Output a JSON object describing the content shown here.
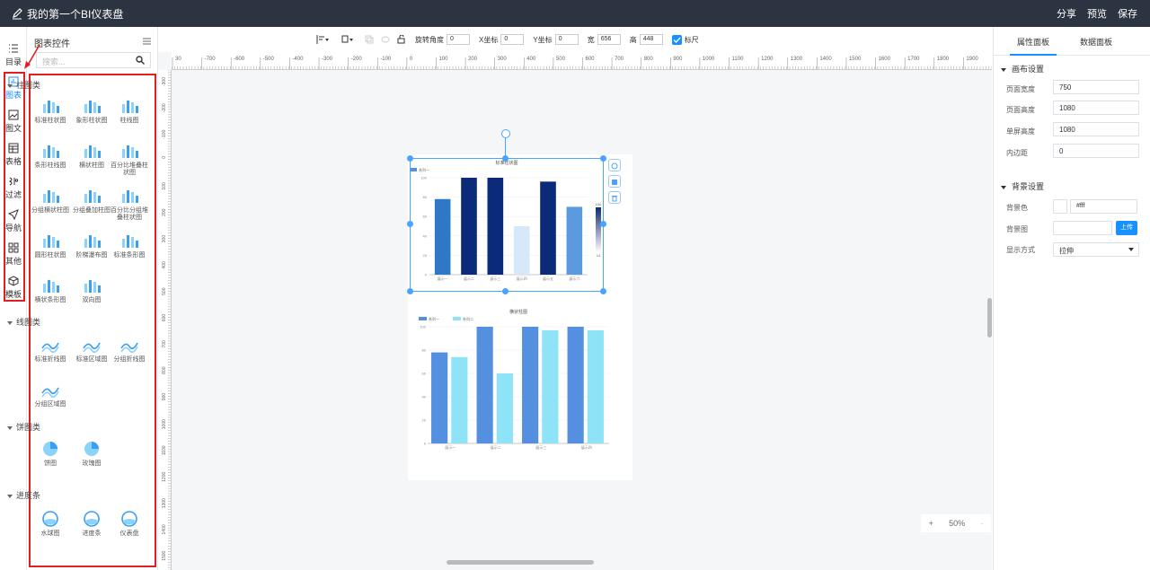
{
  "header": {
    "title": "我的第一个BI仪表盘",
    "actions": [
      "分享",
      "预览",
      "保存"
    ]
  },
  "rail": {
    "items": [
      {
        "label": "目录",
        "icon": "list-icon"
      },
      {
        "label": "图表",
        "icon": "chart-icon",
        "active": true
      },
      {
        "label": "图文",
        "icon": "image-text-icon"
      },
      {
        "label": "表格",
        "icon": "table-icon"
      },
      {
        "label": "过滤",
        "icon": "filter-icon"
      },
      {
        "label": "导航",
        "icon": "navigation-icon"
      },
      {
        "label": "其他",
        "icon": "grid-icon"
      },
      {
        "label": "模板",
        "icon": "cube-icon"
      }
    ]
  },
  "panel": {
    "title": "图表控件",
    "search_placeholder": "搜索...",
    "sections": [
      {
        "name": "柱图类",
        "items": [
          "标准柱状图",
          "象形柱状图",
          "柱线图",
          "条形柱线图",
          "横状柱图",
          "百分比堆叠柱状图",
          "分组横状柱图",
          "分组叠加柱图",
          "百分比分组堆叠柱状图",
          "圆形柱状图",
          "阶梯瀑布图",
          "标准条形图",
          "横状条形图",
          "双向图"
        ]
      },
      {
        "name": "线图类",
        "items": [
          "标准折线图",
          "标准区域图",
          "分组折线图",
          "分组区域图"
        ]
      },
      {
        "name": "饼图类",
        "items": [
          "饼图",
          "玫瑰图"
        ]
      },
      {
        "name": "进度条",
        "items": [
          "水球图",
          "进度条",
          "仪表盘"
        ]
      }
    ]
  },
  "toolbar": {
    "rotate_label": "旋转角度",
    "rotate_value": "0",
    "x_label": "X坐标",
    "x_value": "0",
    "y_label": "Y坐标",
    "y_value": "0",
    "width_label": "宽",
    "width_value": "656",
    "height_label": "高",
    "height_value": "448",
    "ruler_label": "标尺"
  },
  "ruler": {
    "h_ticks": [
      "30",
      "-700",
      "-600",
      "-500",
      "-400",
      "-300",
      "-200",
      "-100",
      "0",
      "100",
      "200",
      "300",
      "400",
      "500",
      "600",
      "700",
      "800",
      "900",
      "1000",
      "1100",
      "1200",
      "1300",
      "1400",
      "1500",
      "1600",
      "1700",
      "1800",
      "1900"
    ],
    "v_ticks": [
      "-300",
      "-200",
      "-100",
      "0",
      "100",
      "200",
      "300",
      "400",
      "500",
      "600",
      "700",
      "800",
      "900",
      "1000",
      "1100",
      "1200",
      "1300",
      "1400",
      "1500"
    ]
  },
  "chart_data": [
    {
      "type": "bar",
      "title": "标准柱状图",
      "categories": [
        "展示一",
        "展示二",
        "展示三",
        "展示四",
        "展示五",
        "展示六"
      ],
      "series": [
        {
          "name": "系列一",
          "values": [
            78,
            100,
            100,
            50,
            96,
            70
          ]
        }
      ],
      "colors": [
        "#2e78c7",
        "#0c2a7a",
        "#0c2a7a",
        "#d6e9fa",
        "#0c2a7a",
        "#5c9ae0"
      ],
      "ylim": [
        0,
        100
      ],
      "yticks": [
        "0",
        "20",
        "40",
        "60",
        "80",
        "100"
      ],
      "visualmap": {
        "max": "100",
        "min": "14"
      }
    },
    {
      "type": "bar",
      "title": "横状柱图",
      "categories": [
        "展示一",
        "展示二",
        "展示三",
        "展示四"
      ],
      "series": [
        {
          "name": "系列一",
          "values": [
            78,
            100,
            100,
            100
          ],
          "color": "#5590e0"
        },
        {
          "name": "系列二",
          "values": [
            74,
            60,
            97,
            97
          ],
          "color": "#8fe3f7"
        }
      ],
      "ylim": [
        0,
        100
      ],
      "yticks": [
        "0",
        "20",
        "40",
        "60",
        "80",
        "100"
      ]
    }
  ],
  "right_panel": {
    "tabs": [
      "属性面板",
      "数据面板"
    ],
    "canvas_settings": {
      "title": "画布设置",
      "rows": [
        {
          "label": "页面宽度",
          "value": "750"
        },
        {
          "label": "页面高度",
          "value": "1080"
        },
        {
          "label": "单屏高度",
          "value": "1080"
        },
        {
          "label": "内边距",
          "value": "0"
        }
      ]
    },
    "background": {
      "title": "背景设置",
      "color_label": "背景色",
      "color_value": "#fff",
      "image_label": "背景图",
      "upload_label": "上传",
      "display_label": "显示方式",
      "display_value": "拉伸"
    }
  },
  "zoom": {
    "minus": "+",
    "value": "50%",
    "plus": "-"
  }
}
